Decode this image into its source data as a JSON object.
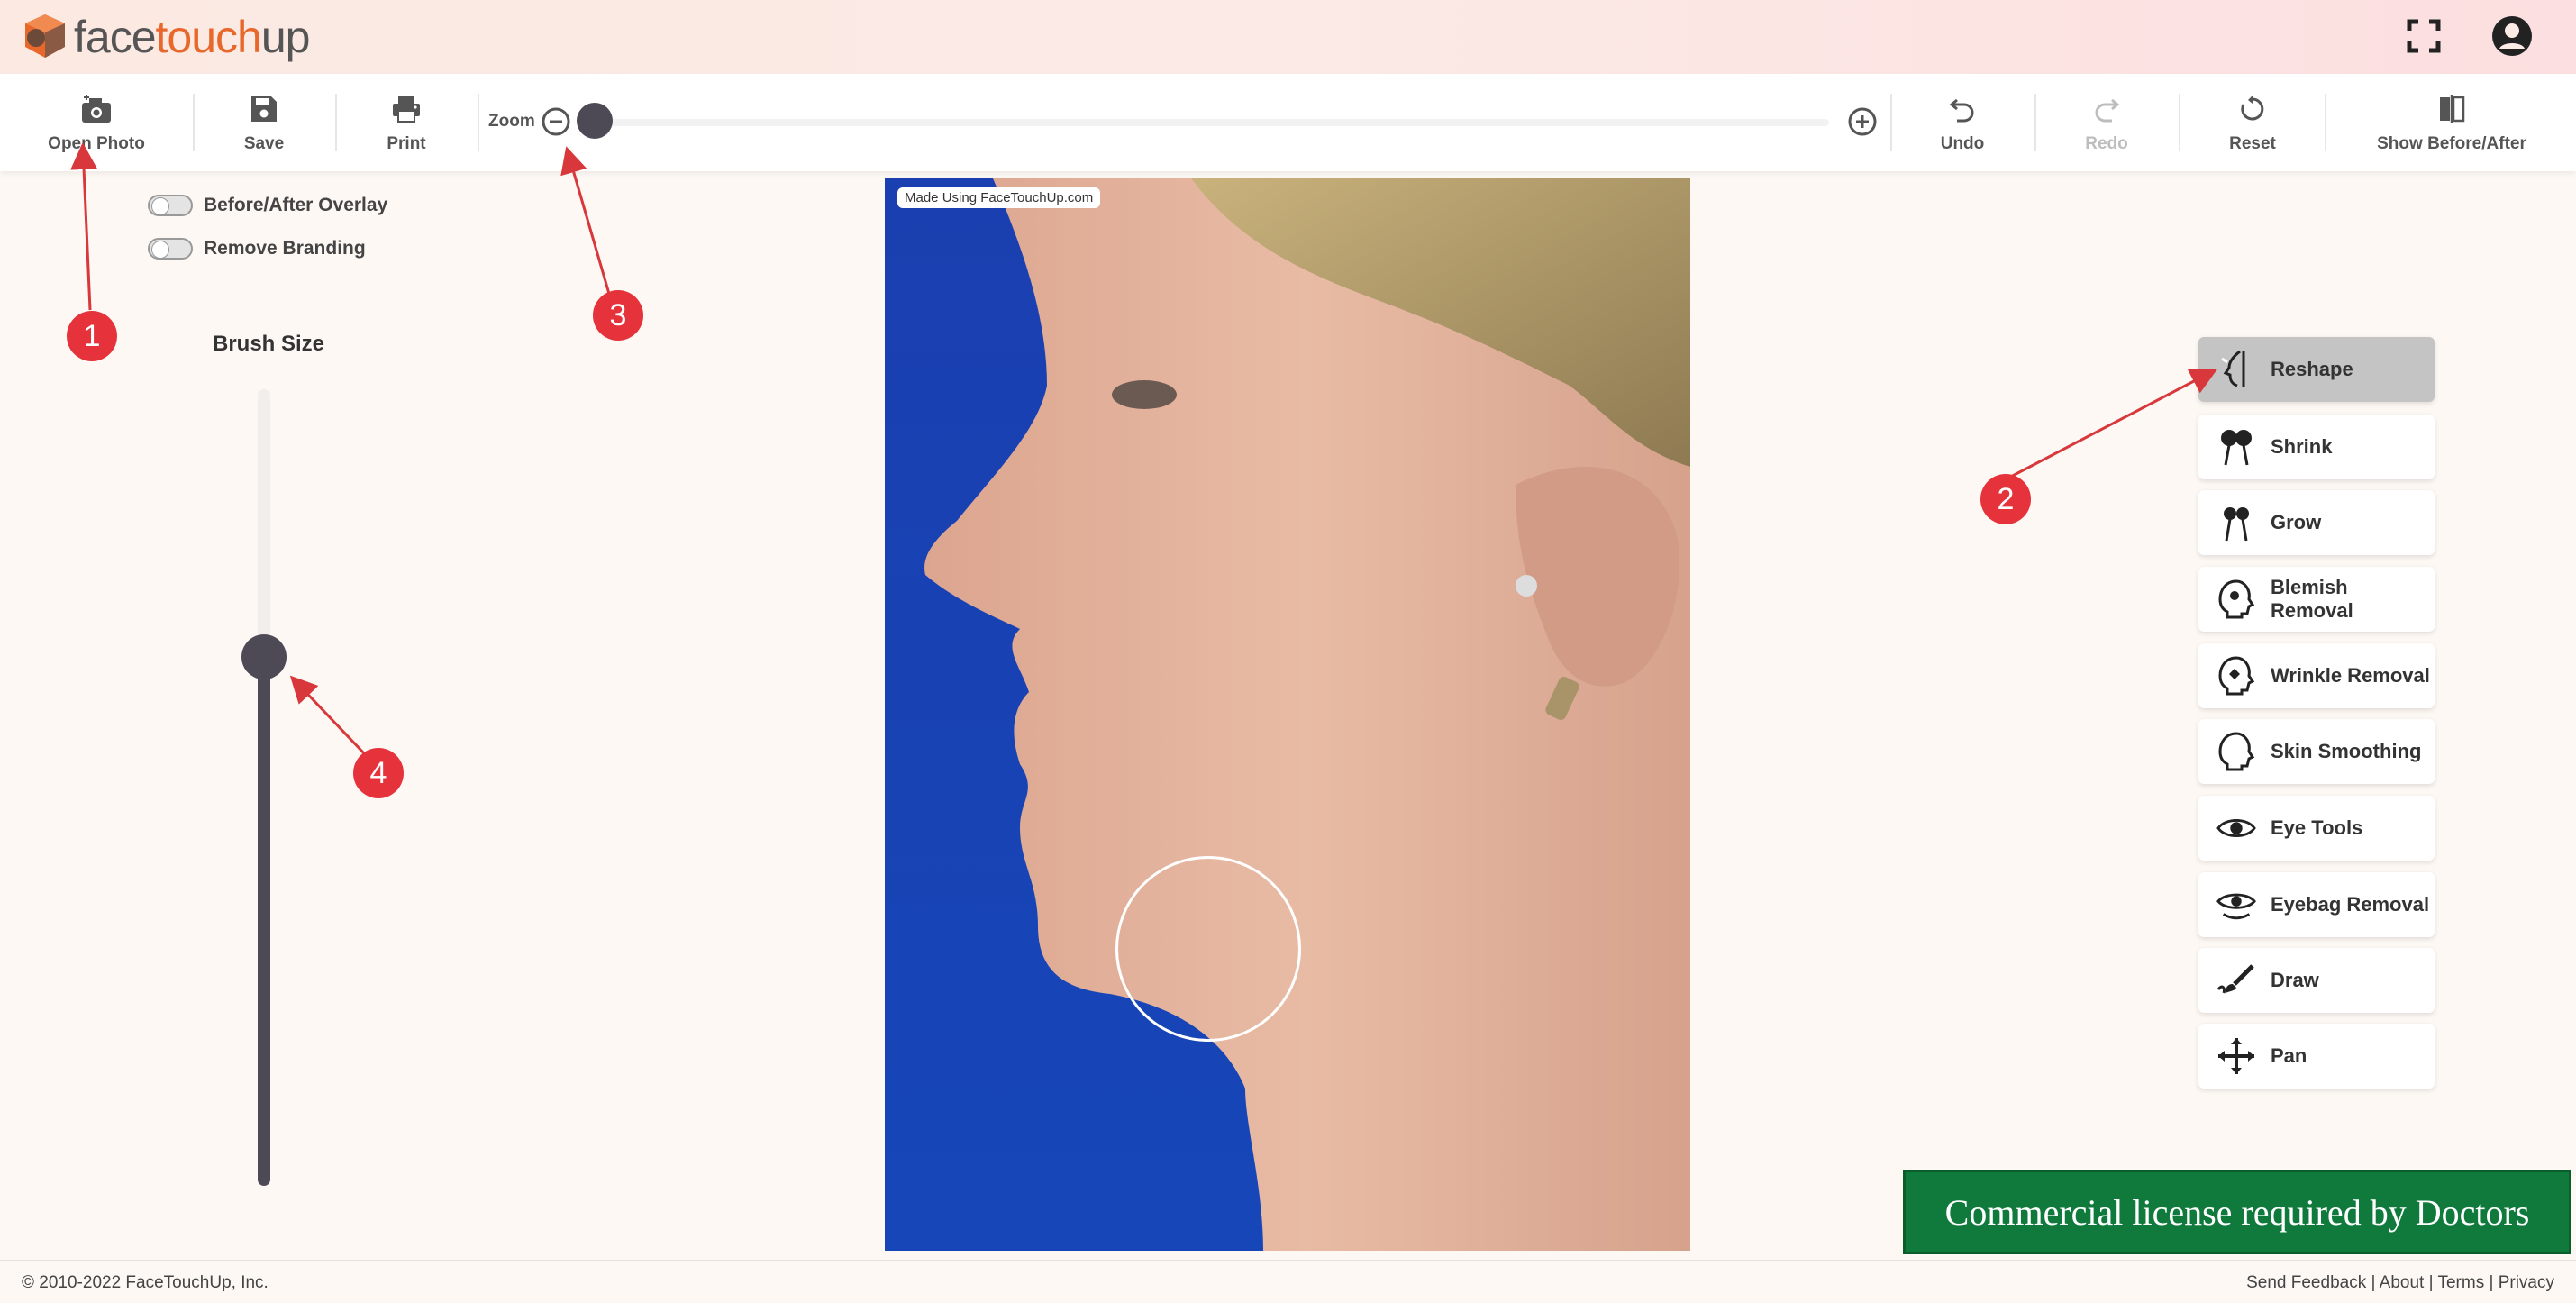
{
  "header": {
    "logo": {
      "part1": "face",
      "part2": "touch",
      "part3": "up"
    },
    "fullscreen_icon": "fullscreen-icon",
    "account_icon": "account-icon"
  },
  "toolbar": {
    "open_photo": "Open Photo",
    "save": "Save",
    "print": "Print",
    "zoom": "Zoom",
    "undo": "Undo",
    "redo": "Redo",
    "reset": "Reset",
    "show_before_after": "Show Before/After"
  },
  "left_panel": {
    "before_after_overlay": "Before/After Overlay",
    "remove_branding": "Remove Branding",
    "brush_size_label": "Brush Size",
    "brush_size_fraction": 0.67
  },
  "zoom_fraction": 0.0,
  "photo": {
    "watermark": "Made Using FaceTouchUp.com"
  },
  "tools": [
    {
      "label": "Reshape",
      "icon": "reshape-icon",
      "active": true
    },
    {
      "label": "Shrink",
      "icon": "shrink-icon"
    },
    {
      "label": "Grow",
      "icon": "grow-icon"
    },
    {
      "label": "Blemish Removal",
      "icon": "blemish-icon"
    },
    {
      "label": "Wrinkle Removal",
      "icon": "wrinkle-icon"
    },
    {
      "label": "Skin Smoothing",
      "icon": "head-icon"
    },
    {
      "label": "Eye Tools",
      "icon": "eye-icon"
    },
    {
      "label": "Eyebag Removal",
      "icon": "eyebag-icon"
    },
    {
      "label": "Draw",
      "icon": "brush-icon"
    },
    {
      "label": "Pan",
      "icon": "move-icon"
    }
  ],
  "annotations": [
    "1",
    "2",
    "3",
    "4"
  ],
  "license_banner": "Commercial license required by Doctors",
  "footer": {
    "copyright": "© 2010-2022 FaceTouchUp, Inc.",
    "send_feedback": "Send Feedback",
    "about": "About",
    "terms": "Terms",
    "privacy": "Privacy",
    "separator": " | "
  },
  "colors": {
    "accent": "#e8672a",
    "slider": "#4d4a56",
    "annotation": "#e5323b",
    "license": "#0f7a3c"
  }
}
